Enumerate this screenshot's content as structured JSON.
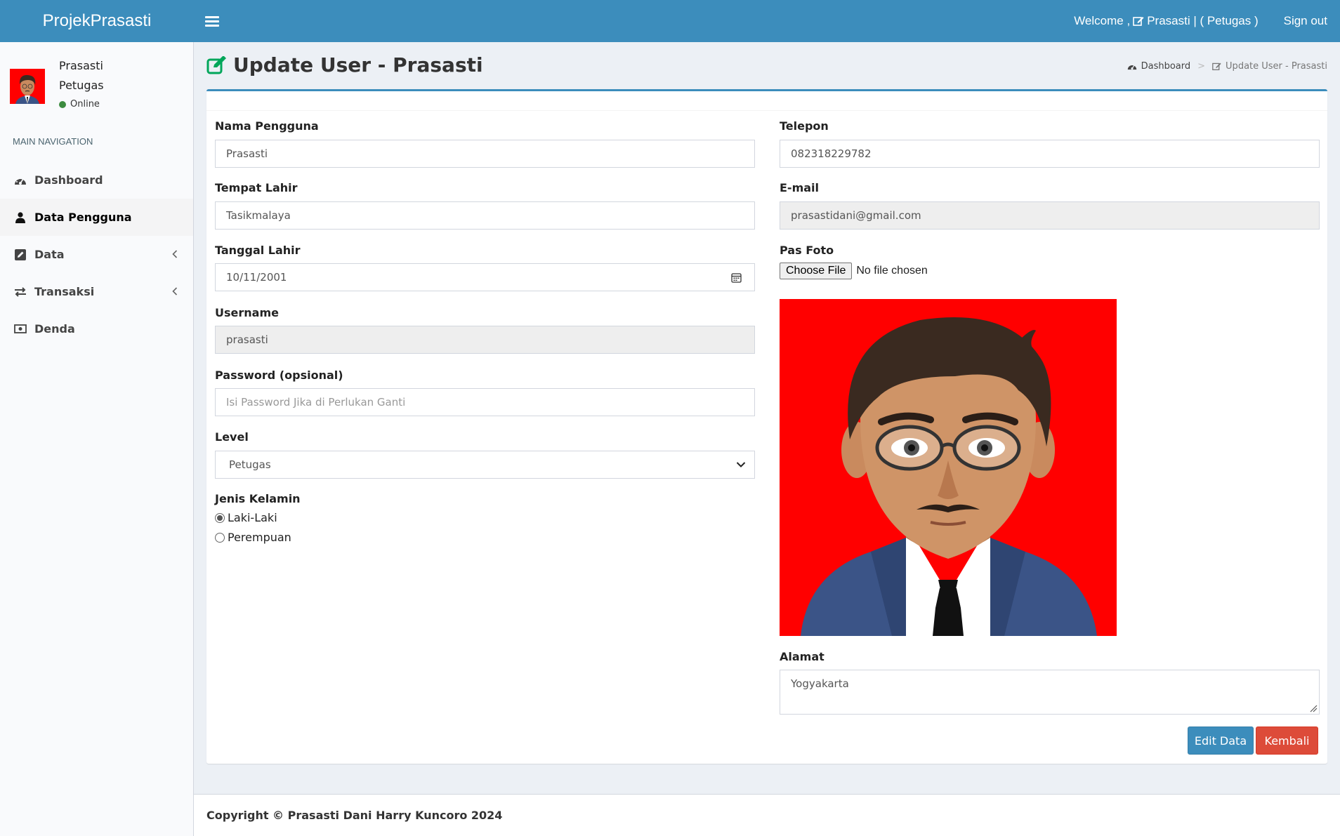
{
  "app": {
    "brand": "ProjekPrasasti"
  },
  "topnav": {
    "welcome_prefix": "Welcome ,",
    "welcome_user": "Prasasti | ( Petugas )",
    "signout": "Sign out"
  },
  "sidebar": {
    "user": {
      "name": "Prasasti",
      "role": "Petugas",
      "status": "Online"
    },
    "nav_header": "MAIN NAVIGATION",
    "items": [
      {
        "label": "Dashboard",
        "icon": "dashboard-icon"
      },
      {
        "label": "Data Pengguna",
        "icon": "user-icon",
        "active": true
      },
      {
        "label": "Data",
        "icon": "edit-square-icon",
        "has_children": true
      },
      {
        "label": "Transaksi",
        "icon": "exchange-icon",
        "has_children": true
      },
      {
        "label": "Denda",
        "icon": "money-icon"
      }
    ]
  },
  "page": {
    "title": "Update User - Prasasti",
    "breadcrumb": {
      "home": "Dashboard",
      "current": "Update User - Prasasti"
    }
  },
  "form": {
    "nama": {
      "label": "Nama Pengguna",
      "value": "Prasasti"
    },
    "tempat_lahir": {
      "label": "Tempat Lahir",
      "value": "Tasikmalaya"
    },
    "tanggal_lahir": {
      "label": "Tanggal Lahir",
      "value": "10/11/2001"
    },
    "username": {
      "label": "Username",
      "value": "prasasti"
    },
    "password": {
      "label": "Password (opsional)",
      "placeholder": "Isi Password Jika di Perlukan Ganti"
    },
    "level": {
      "label": "Level",
      "value": "Petugas"
    },
    "jenis_kelamin": {
      "label": "Jenis Kelamin",
      "options": [
        "Laki-Laki",
        "Perempuan"
      ],
      "selected": "Laki-Laki"
    },
    "telepon": {
      "label": "Telepon",
      "value": "082318229782"
    },
    "email": {
      "label": "E-mail",
      "value": "prasastidani@gmail.com"
    },
    "pas_foto": {
      "label": "Pas Foto",
      "button": "Choose File",
      "status": "No file chosen"
    },
    "alamat": {
      "label": "Alamat",
      "value": "Yogyakarta"
    },
    "buttons": {
      "edit": "Edit Data",
      "back": "Kembali"
    }
  },
  "footer": {
    "copyright": "Copyright © Prasasti Dani Harry Kuncoro 2024"
  },
  "colors": {
    "primary": "#3c8dbc",
    "danger": "#dd4b39",
    "photo_bg": "#ff0000",
    "online": "#3d8c40"
  }
}
